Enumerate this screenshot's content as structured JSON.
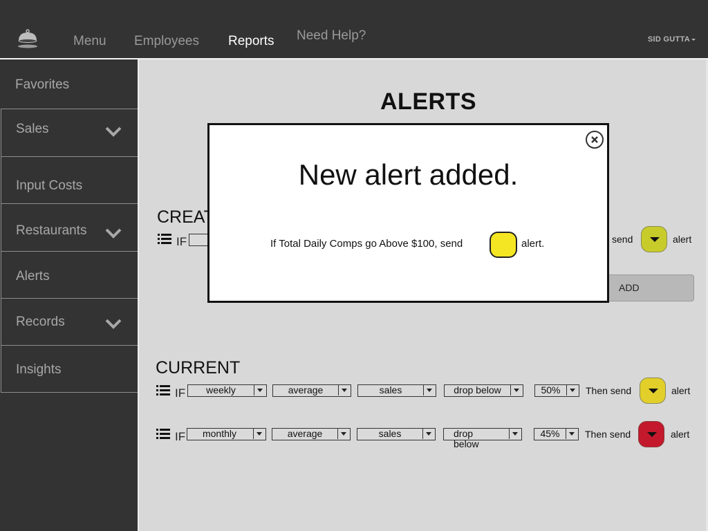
{
  "topbar": {
    "logo_icon": "cloche-icon",
    "nav": [
      {
        "label": "Menu",
        "active": false
      },
      {
        "label": "Employees",
        "active": false
      },
      {
        "label": "Reports",
        "active": true
      },
      {
        "label": "Need Help?",
        "active": false
      }
    ],
    "user": "SID GUTTA"
  },
  "sidebar": {
    "items": [
      {
        "label": "Favorites",
        "expandable": false
      },
      {
        "label": "Sales",
        "expandable": true
      },
      {
        "label": "Input Costs",
        "expandable": false
      },
      {
        "label": "Restaurants",
        "expandable": true
      },
      {
        "label": "Alerts",
        "expandable": false
      },
      {
        "label": "Records",
        "expandable": true
      },
      {
        "label": "Insights",
        "expandable": false
      }
    ]
  },
  "main": {
    "title": "ALERTS",
    "create": {
      "title": "CREATE",
      "if_label": "IF",
      "send_label": "send",
      "alert_label": "alert",
      "color": "#c8cc2a",
      "add_label": "ADD"
    },
    "current": {
      "title": "CURRENT",
      "rows": [
        {
          "if_label": "IF",
          "period": "weekly",
          "metric": "average",
          "measure": "sales",
          "condition": "drop below",
          "threshold": "50%",
          "then_label": "Then send",
          "color": "#e2cf2a",
          "alert_label": "alert"
        },
        {
          "if_label": "IF",
          "period": "monthly",
          "metric": "average",
          "measure": "sales",
          "condition": "drop below",
          "threshold": "45%",
          "then_label": "Then send",
          "color": "#c4182c",
          "alert_label": "alert"
        }
      ]
    }
  },
  "modal": {
    "title": "New alert added.",
    "message": "If Total Daily Comps go Above $100, send",
    "alert_word": "alert.",
    "swatch_color": "#f5e623"
  }
}
